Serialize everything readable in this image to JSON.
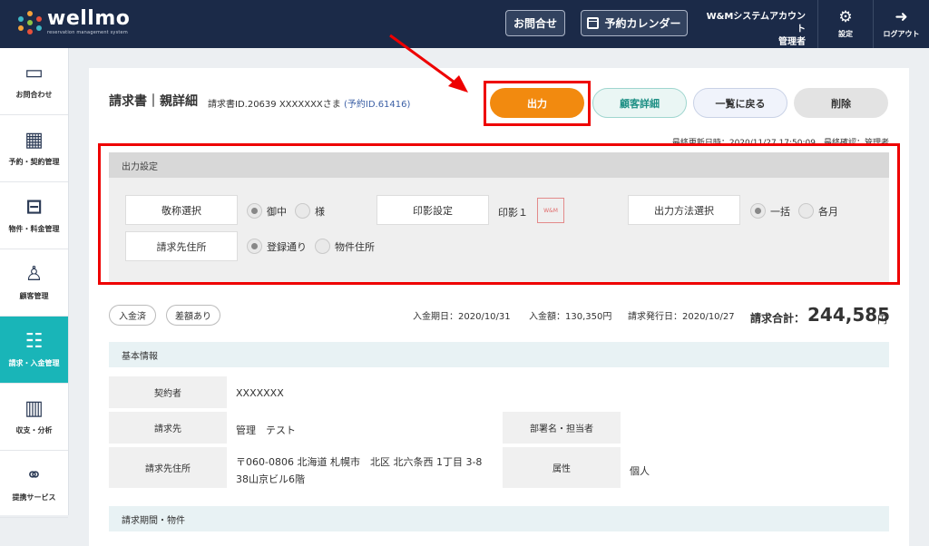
{
  "header": {
    "logo_word": "wellmo",
    "logo_tagline": "reservation management system",
    "contact_button": "お問合せ",
    "calendar_button": "予約カレンダー",
    "account_name": "W&Mシステムアカウント",
    "account_role": "管理者",
    "settings_label": "設定",
    "logout_label": "ログアウト"
  },
  "sidebar": {
    "items": [
      {
        "label": "お問合わせ",
        "icon": "message-icon"
      },
      {
        "label": "予約・契約管理",
        "icon": "calendar-icon"
      },
      {
        "label": "物件・料金管理",
        "icon": "sofa-icon"
      },
      {
        "label": "顧客管理",
        "icon": "person-icon"
      },
      {
        "label": "請求・入金管理",
        "icon": "invoice-icon"
      },
      {
        "label": "収支・分析",
        "icon": "bar-chart-icon"
      },
      {
        "label": "提携サービス",
        "icon": "network-icon"
      }
    ]
  },
  "page": {
    "title": "請求書｜親詳細",
    "invoice_id": "請求書ID.20639 XXXXXXXさま",
    "reservation_id": "(予約ID.61416)",
    "last_update": "最終更新日時：2020/11/27 17:50:09　最終確認：管理者"
  },
  "actions": {
    "output": "出力",
    "customer_detail": "顧客詳細",
    "back_to_list": "一覧に戻る",
    "delete": "削除"
  },
  "output_settings": {
    "heading": "出力設定",
    "honorific_label": "敬称選択",
    "honorific_options": [
      "御中",
      "様"
    ],
    "stamp_label": "印影設定",
    "stamp_value": "印影１",
    "stamp_mark": "W&M",
    "method_label": "出力方法選択",
    "method_options": [
      "一括",
      "各月"
    ],
    "address_label": "請求先住所",
    "address_options": [
      "登録通り",
      "物件住所"
    ]
  },
  "tags": {
    "paid": "入金済",
    "difference": "差額あり"
  },
  "summary": {
    "due_date": "入金期日：2020/10/31",
    "paid_amount": "入金額：130,350円",
    "issue_date": "請求発行日：2020/10/27",
    "total_label": "請求合計：",
    "total_value": "244,585",
    "total_unit": "円"
  },
  "basic_info": {
    "heading": "基本情報",
    "contractor_label": "契約者",
    "contractor_value": "XXXXXXX",
    "billto_label": "請求先",
    "billto_value": "管理　テスト",
    "dept_label": "部署名・担当者",
    "address_label": "請求先住所",
    "address_line1": "〒060-0806 北海道 札幌市　北区 北六条西 1丁目 3-8",
    "address_line2": "38山京ビル6階",
    "attribute_label": "属性",
    "attribute_value": "個人"
  },
  "period": {
    "heading": "請求期間・物件"
  }
}
